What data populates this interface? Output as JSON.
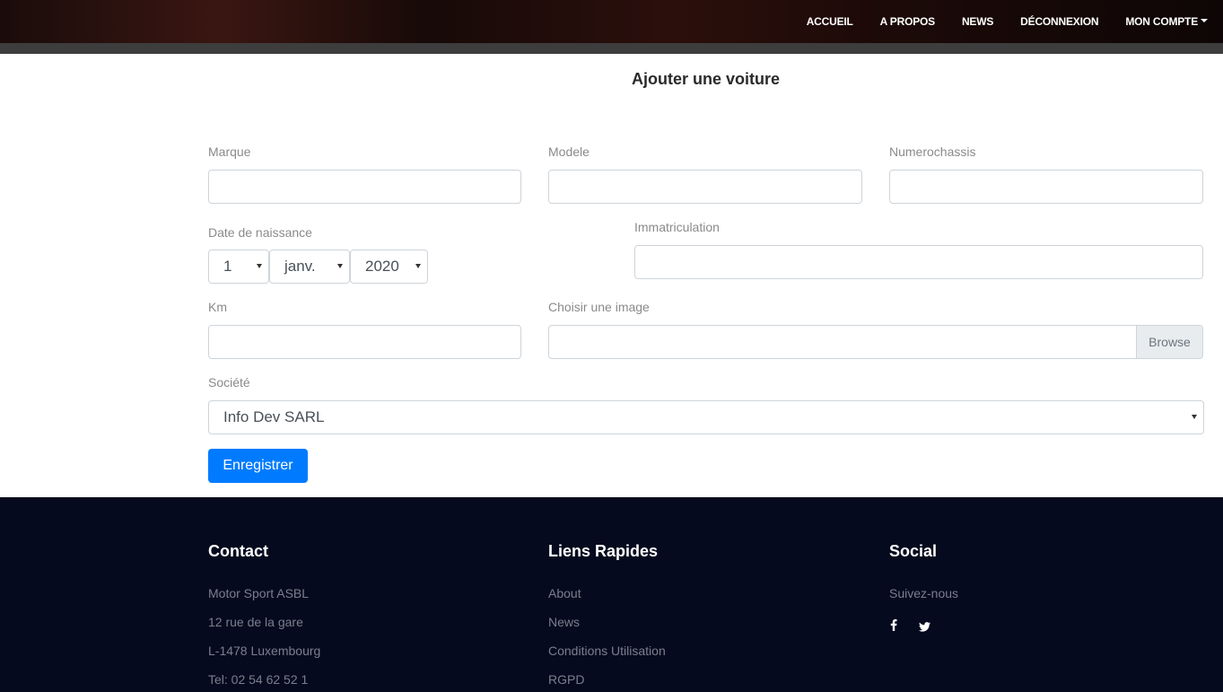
{
  "nav": {
    "items": [
      {
        "label": "ACCUEIL"
      },
      {
        "label": "A PROPOS"
      },
      {
        "label": "NEWS"
      },
      {
        "label": "DÉCONNEXION"
      },
      {
        "label": "MON COMPTE"
      }
    ]
  },
  "page": {
    "title": "Ajouter une voiture"
  },
  "form": {
    "marque_label": "Marque",
    "modele_label": "Modele",
    "chassis_label": "Numerochassis",
    "date_label": "Date de naissance",
    "day_value": "1",
    "month_value": "janv.",
    "year_value": "2020",
    "immat_label": "Immatriculation",
    "km_label": "Km",
    "image_label": "Choisir une image",
    "browse_label": "Browse",
    "societe_label": "Société",
    "societe_value": "Info Dev SARL",
    "save_label": "Enregistrer"
  },
  "footer": {
    "contact": {
      "title": "Contact",
      "lines": [
        "Motor Sport ASBL",
        "12 rue de la gare",
        "L-1478 Luxembourg",
        "Tel: 02 54 62 52 1"
      ]
    },
    "links": {
      "title": "Liens Rapides",
      "items": [
        "About",
        "News",
        "Conditions Utilisation",
        "RGPD"
      ]
    },
    "social": {
      "title": "Social",
      "text": "Suivez-nous",
      "icons": [
        "facebook-icon",
        "twitter-icon"
      ]
    }
  }
}
